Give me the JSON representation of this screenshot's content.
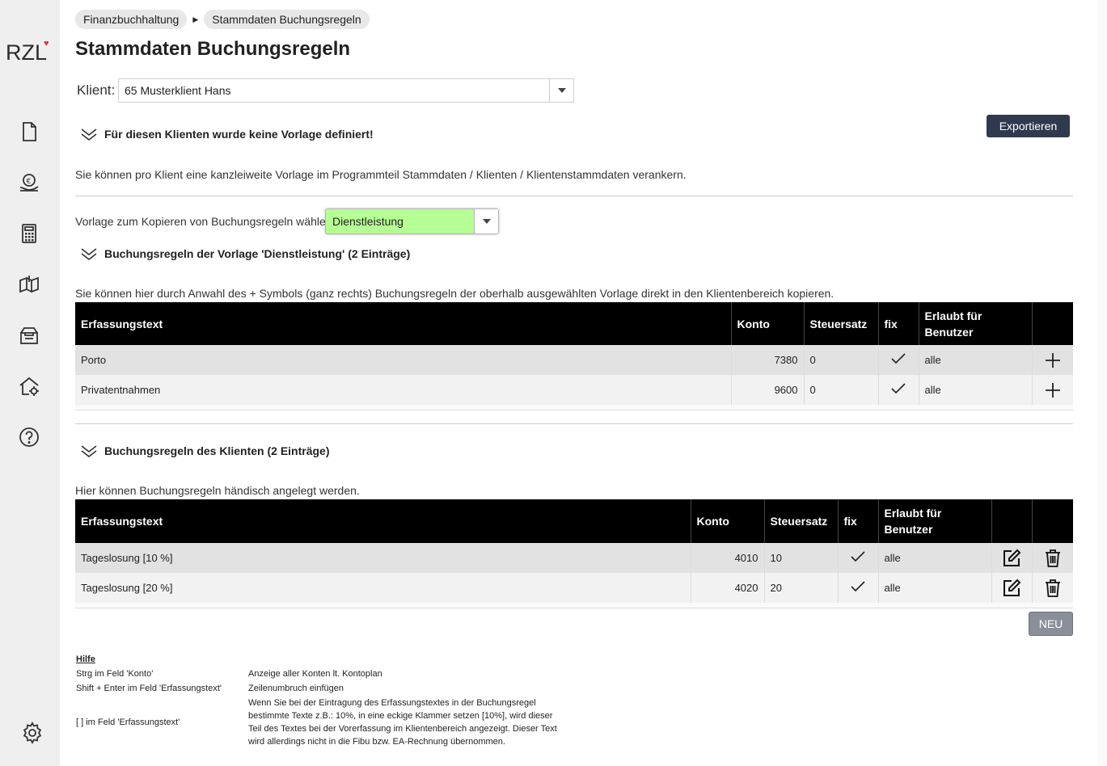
{
  "logo": {
    "text": "RZL"
  },
  "sidebar": {
    "items": [
      {
        "icon": "document-icon"
      },
      {
        "icon": "euro-hand-icon"
      },
      {
        "icon": "calculator-icon"
      },
      {
        "icon": "book-icon"
      },
      {
        "icon": "archive-box-icon"
      },
      {
        "icon": "home-settings-icon"
      },
      {
        "icon": "help-icon"
      }
    ],
    "bottom_icon": "gear-icon"
  },
  "breadcrumb": [
    "Finanzbuchhaltung",
    "Stammdaten Buchungsregeln"
  ],
  "page_title": "Stammdaten Buchungsregeln",
  "klient": {
    "label": "Klient:",
    "value": "65 Musterklient Hans"
  },
  "export_label": "Exportieren",
  "no_template": {
    "heading": "Für diesen Klienten wurde keine Vorlage definiert!",
    "text": "Sie können pro Klient eine kanzleiweite Vorlage im Programmteil Stammdaten / Klienten / Klientenstammdaten verankern."
  },
  "vorlage": {
    "label": "Vorlage zum Kopieren von Buchungsregeln wählen:",
    "value": "Dienstleistung"
  },
  "template_rules": {
    "heading": "Buchungsregeln der Vorlage 'Dienstleistung' (2 Einträge)",
    "text": "Sie können hier durch Anwahl des + Symbols (ganz rechts) Buchungsregeln der oberhalb ausgewählten Vorlage direkt in den Klientenbereich kopieren.",
    "columns": {
      "text": "Erfassungstext",
      "konto": "Konto",
      "steuersatz": "Steuersatz",
      "fix": "fix",
      "erlaubt1": "Erlaubt für",
      "erlaubt2": "Benutzer"
    },
    "rows": [
      {
        "text": "Porto",
        "konto": "7380",
        "steuersatz": "0",
        "fix": true,
        "erlaubt": "alle"
      },
      {
        "text": "Privatentnahmen",
        "konto": "9600",
        "steuersatz": "0",
        "fix": true,
        "erlaubt": "alle"
      }
    ]
  },
  "client_rules": {
    "heading": "Buchungsregeln des Klienten (2 Einträge)",
    "text": "Hier können Buchungsregeln händisch angelegt werden.",
    "columns": {
      "text": "Erfassungstext",
      "konto": "Konto",
      "steuersatz": "Steuersatz",
      "fix": "fix",
      "erlaubt1": "Erlaubt für",
      "erlaubt2": "Benutzer"
    },
    "rows": [
      {
        "text": "Tageslosung [10 %]",
        "konto": "4010",
        "steuersatz": "10",
        "fix": true,
        "erlaubt": "alle"
      },
      {
        "text": "Tageslosung [20 %]",
        "konto": "4020",
        "steuersatz": "20",
        "fix": true,
        "erlaubt": "alle"
      }
    ]
  },
  "neu_label": "NEU",
  "hilfe": {
    "title": "Hilfe",
    "rows": [
      {
        "key": "Strg im Feld 'Konto'",
        "desc": "Anzeige aller Konten lt. Kontoplan"
      },
      {
        "key": "Shift + Enter im Feld 'Erfassungstext'",
        "desc": "Zeilenumbruch einfügen"
      },
      {
        "key": "[ ] im Feld 'Erfassungstext'",
        "desc": "Wenn Sie bei der Eintragung des Erfassungstextes in der Buchungsregel bestimmte Texte z.B.: 10%, in eine eckige Klammer setzen [10%], wird dieser Teil des Textes bei der Vorerfassung im Klientenbereich angezeigt. Dieser Text wird allerdings nicht in die Fibu bzw. EA-Rechnung übernommen."
      }
    ]
  }
}
